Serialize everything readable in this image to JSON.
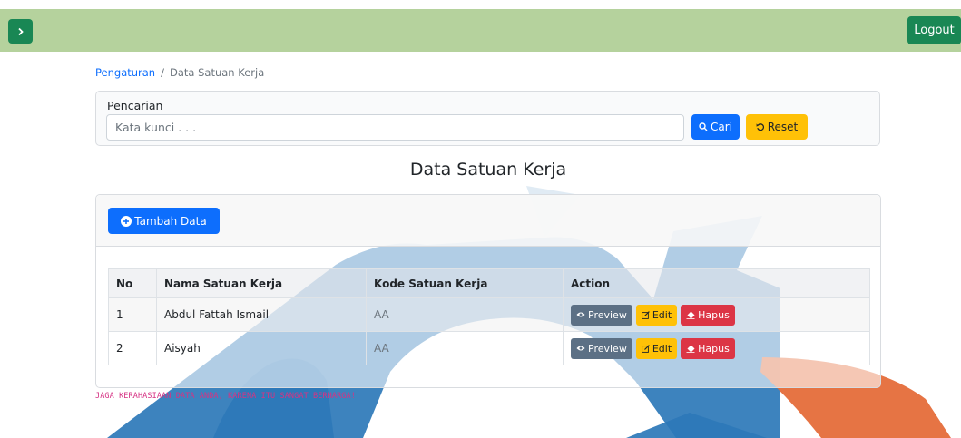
{
  "topbar": {
    "logout_label": "Logout",
    "toggle_icon": "chevron-right-icon",
    "bg_color": "#b5d29d"
  },
  "breadcrumb": {
    "parent": "Pengaturan",
    "separator": "/",
    "current": "Data Satuan Kerja"
  },
  "search": {
    "label": "Pencarian",
    "placeholder": "Kata kunci . . .",
    "value": "",
    "search_button": "Cari",
    "reset_button": "Reset"
  },
  "page": {
    "title": "Data Satuan Kerja"
  },
  "table_card": {
    "add_button": "Tambah Data",
    "columns": [
      "No",
      "Nama Satuan Kerja",
      "Kode Satuan Kerja",
      "Action"
    ],
    "rows": [
      {
        "no": "1",
        "nama": "Abdul Fattah Ismail",
        "kode": "AA"
      },
      {
        "no": "2",
        "nama": "Aisyah",
        "kode": "AA"
      }
    ],
    "action_labels": {
      "preview": "Preview",
      "edit": "Edit",
      "hapus": "Hapus"
    }
  },
  "footer": {
    "note": "JAGA KERAHASIAAN DATA ANDA, KARENA ITU SANGAT BERHARGA!"
  },
  "colors": {
    "primary": "#0d6efd",
    "warning": "#ffc107",
    "danger": "#dc3545",
    "success": "#198754",
    "secondary": "#5c7085"
  }
}
